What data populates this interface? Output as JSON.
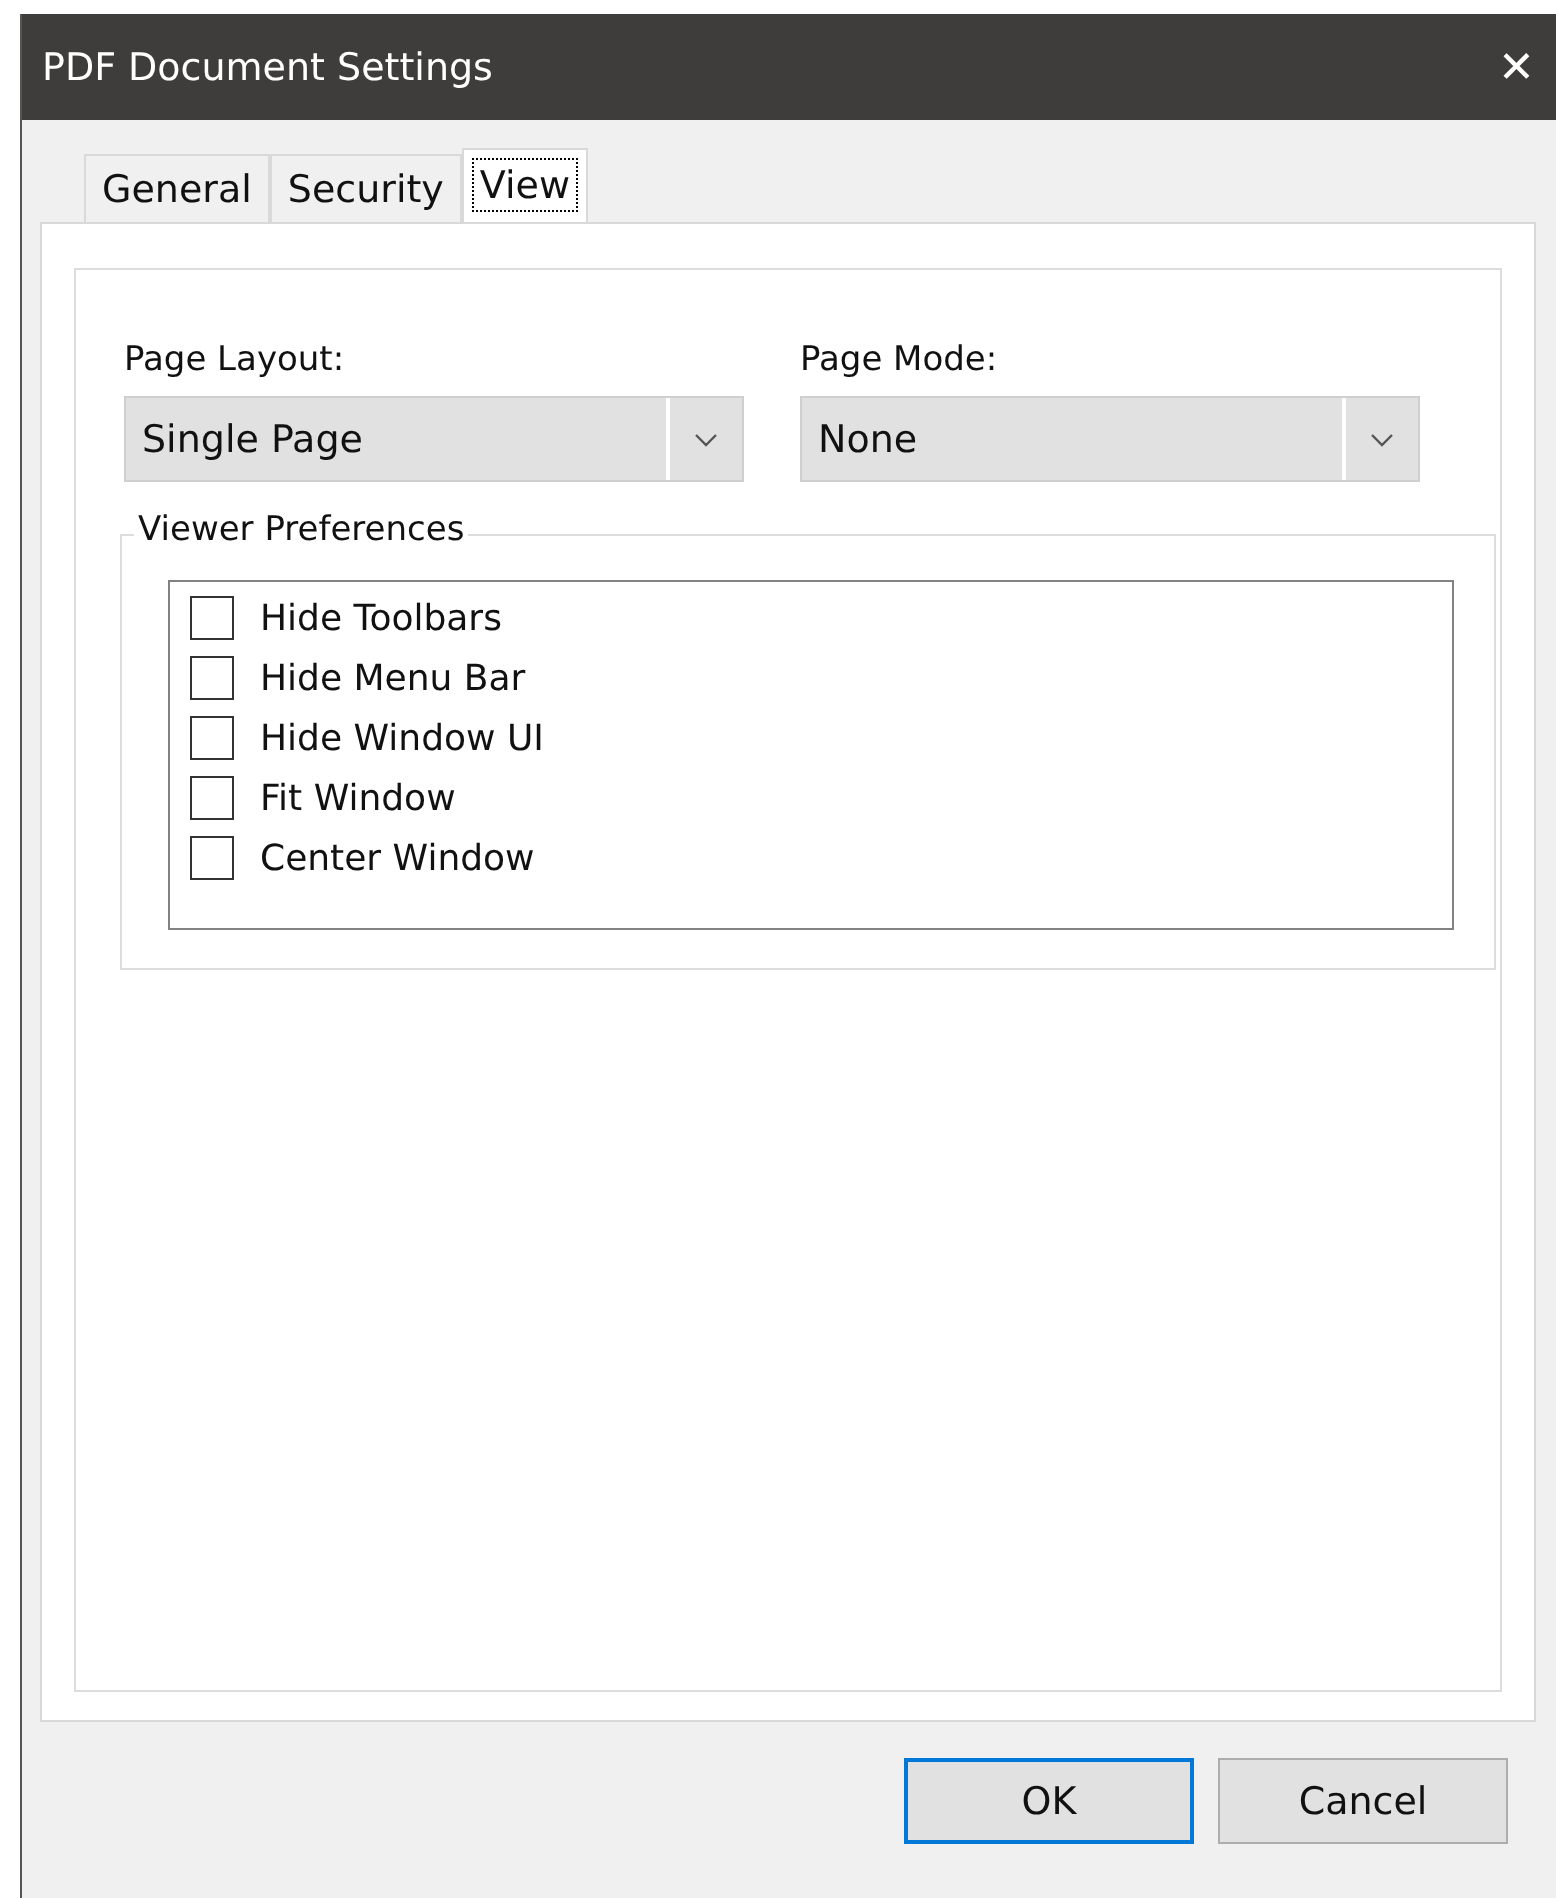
{
  "window": {
    "title": "PDF Document Settings",
    "close": "✕"
  },
  "tabs": [
    {
      "label": "General",
      "selected": false
    },
    {
      "label": "Security",
      "selected": false
    },
    {
      "label": "View",
      "selected": true
    }
  ],
  "page_layout": {
    "label": "Page Layout:",
    "value": "Single Page"
  },
  "page_mode": {
    "label": "Page Mode:",
    "value": "None"
  },
  "viewer_preferences": {
    "title": "Viewer Preferences",
    "items": [
      {
        "label": "Hide Toolbars",
        "checked": false
      },
      {
        "label": "Hide Menu Bar",
        "checked": false
      },
      {
        "label": "Hide Window UI",
        "checked": false
      },
      {
        "label": "Fit Window",
        "checked": false
      },
      {
        "label": "Center Window",
        "checked": false
      }
    ]
  },
  "buttons": [
    {
      "label": "OK",
      "default": true
    },
    {
      "label": "Cancel",
      "default": false
    }
  ]
}
